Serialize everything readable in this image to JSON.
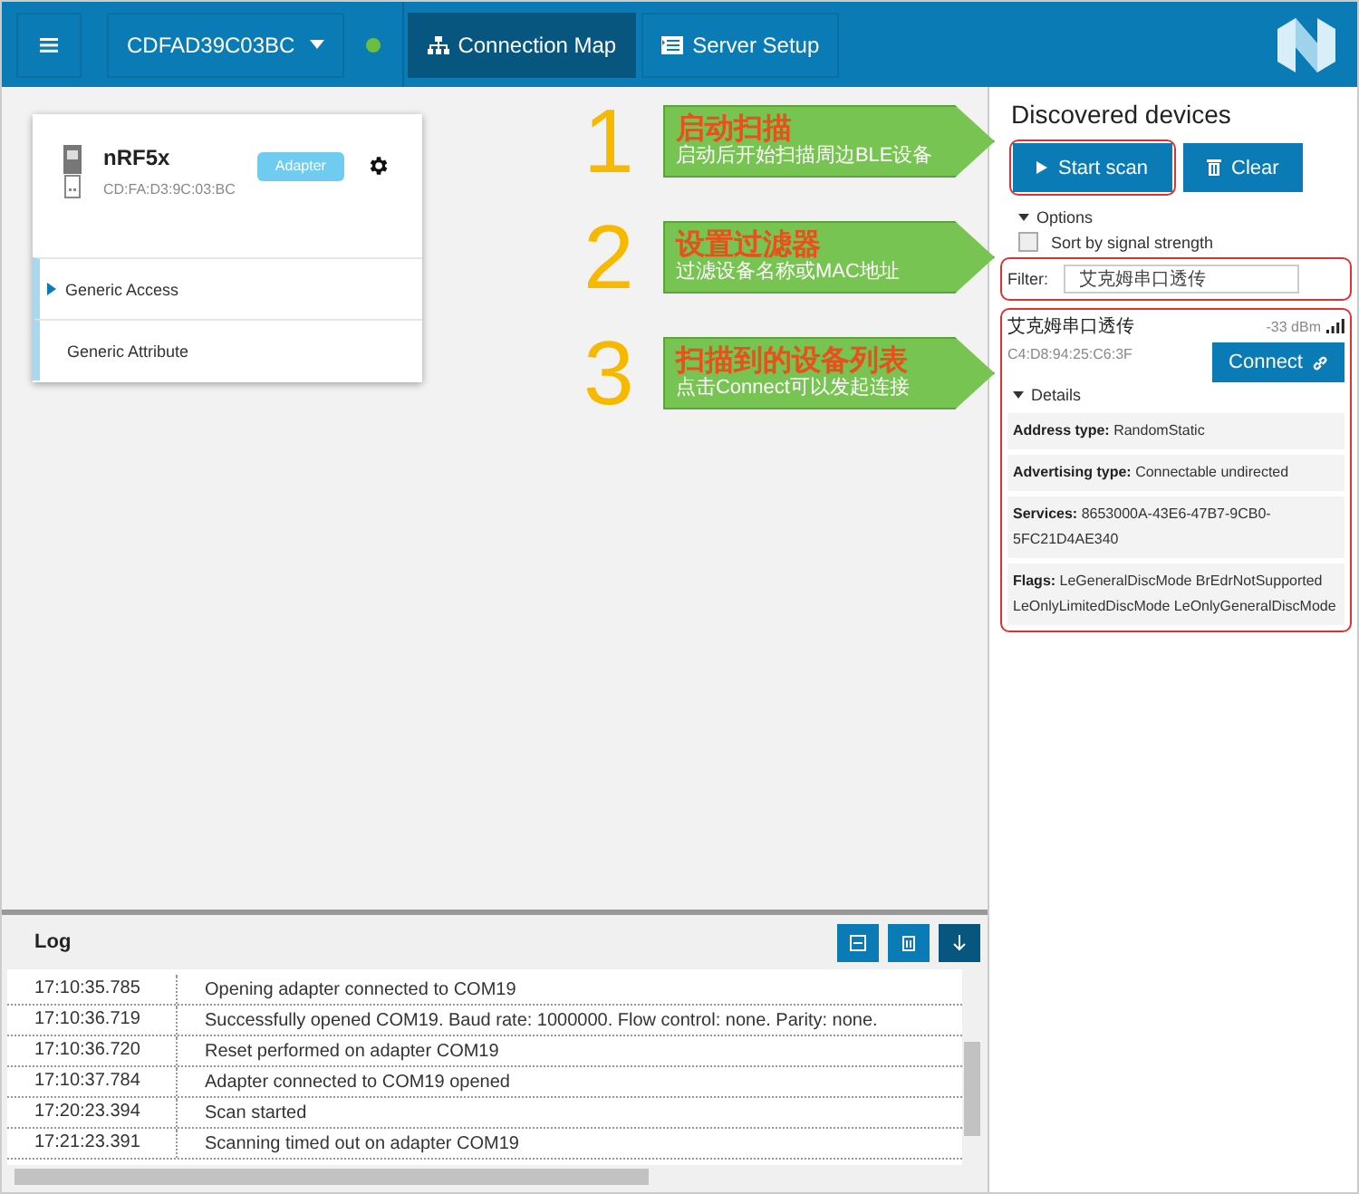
{
  "top_bar": {
    "device_selector": "CDFAD39C03BC",
    "connected": true,
    "tabs": [
      {
        "label": "Connection Map",
        "kind": "map",
        "selected": true
      },
      {
        "label": "Server Setup",
        "kind": "server",
        "selected": false
      }
    ]
  },
  "adapter": {
    "name": "nRF5x",
    "address": "CD:FA:D3:9C:03:BC",
    "badge": "Adapter",
    "services": [
      {
        "label": "Generic Access",
        "expandable": true
      },
      {
        "label": "Generic Attribute",
        "expandable": false
      }
    ]
  },
  "annotations": [
    {
      "number": "1",
      "title": "启动扫描",
      "text": "启动后开始扫描周边BLE设备"
    },
    {
      "number": "2",
      "title": "设置过滤器",
      "text": "过滤设备名称或MAC地址"
    },
    {
      "number": "3",
      "title": "扫描到的设备列表",
      "text": "点击Connect可以发起连接"
    }
  ],
  "discovered": {
    "title": "Discovered devices",
    "start_scan": "Start scan",
    "clear": "Clear",
    "options_label": "Options",
    "options_expanded": true,
    "sort_option": {
      "label": "Sort by signal strength",
      "checked": false
    },
    "filter": {
      "label": "Filter:",
      "value": "艾克姆串口透传"
    },
    "devices": [
      {
        "name": "艾克姆串口透传",
        "rssi": "-33 dBm",
        "address": "C4:D8:94:25:C6:3F",
        "connect": "Connect",
        "details_label": "Details",
        "details_expanded": true,
        "details": [
          "**Address type:** RandomStatic",
          "**Advertising type:** Connectable undirected",
          "**Services:** 8653000A-43E6-47B7-9CB0-5FC21D4AE340",
          "**Flags:** LeGeneralDiscMode BrEdrNotSupported LeOnlyLimitedDiscMode LeOnlyGeneralDiscMode"
        ]
      }
    ]
  },
  "log": {
    "title": "Log",
    "entries": [
      {
        "time": "17:10:35.785",
        "message": "Opening adapter connected to COM19"
      },
      {
        "time": "17:10:36.719",
        "message": "Successfully opened COM19. Baud rate: 1000000. Flow control: none. Parity: none."
      },
      {
        "time": "17:10:36.720",
        "message": "Reset performed on adapter COM19"
      },
      {
        "time": "17:10:37.784",
        "message": "Adapter connected to COM19 opened"
      },
      {
        "time": "17:20:23.394",
        "message": "Scan started"
      },
      {
        "time": "17:21:23.391",
        "message": "Scanning timed out on adapter COM19"
      }
    ]
  }
}
